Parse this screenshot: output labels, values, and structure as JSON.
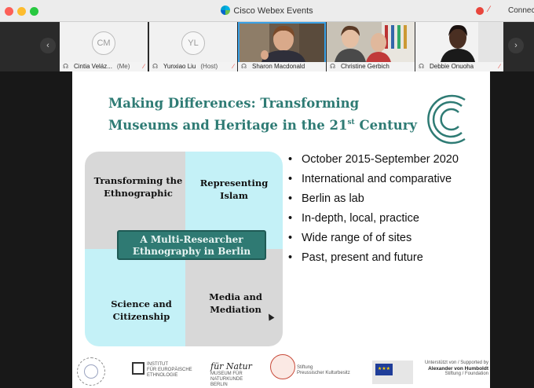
{
  "window": {
    "app_title": "Cisco Webex Events",
    "connect_label": "Connect",
    "app_icon": "webex-logo-icon"
  },
  "participants": [
    {
      "name": "Cintia Veláz...",
      "suffix": "(Me)",
      "initials": "CM",
      "video": false,
      "muted": true
    },
    {
      "name": "Yunxiao Liu",
      "suffix": "(Host)",
      "initials": "YL",
      "video": false,
      "muted": true
    },
    {
      "name": "Sharon Macdonald",
      "suffix": "",
      "initials": "",
      "video": true,
      "muted": false,
      "active": true
    },
    {
      "name": "Christine Gerbich",
      "suffix": "",
      "initials": "",
      "video": true,
      "muted": false
    },
    {
      "name": "Debbie Onuoha",
      "suffix": "",
      "initials": "",
      "video": true,
      "muted": true
    }
  ],
  "slide": {
    "title_line1": "Making Differences: Transforming",
    "title_line2_pre": "Museums and Heritage in the 21",
    "title_sup": "st",
    "title_line2_post": " Century",
    "quadrants": {
      "top_left": "Transforming the Ethnographic",
      "top_right": "Representing Islam",
      "bottom_left": "Science and Citizenship",
      "bottom_right": "Media and Mediation"
    },
    "center_label_line1": "A Multi-Researcher",
    "center_label_line2": "Ethnography in Berlin",
    "bullets": [
      "October 2015-September 2020",
      "International and comparative",
      "Berlin as lab",
      "In-depth, local, practice",
      "Wide range of of sites",
      "Past, present and future"
    ],
    "logos": {
      "institut_line1": "INSTITUT",
      "institut_line2": "FÜR EUROPÄISCHE",
      "institut_line3": "ETHNOLOGIE",
      "natur_script": "für Natur",
      "natur_line1": "MUSEUM FÜR",
      "natur_line2": "NATURKUNDE",
      "natur_line3": "BERLIN",
      "prussian_line1": "Stiftung",
      "prussian_line2": "Preussischer Kulturbesitz",
      "avh_small": "Unterstützt von / Supported by",
      "avh_name": "Alexander von Humboldt",
      "avh_sub": "Stiftung / Foundation"
    }
  },
  "colors": {
    "title_teal": "#2e7b74",
    "quad_grey": "#d8d8d8",
    "quad_cyan": "#c4f1f7",
    "center_box": "#2f7a73",
    "active_outline": "#39a0e5",
    "mute_red": "#e8453c"
  }
}
